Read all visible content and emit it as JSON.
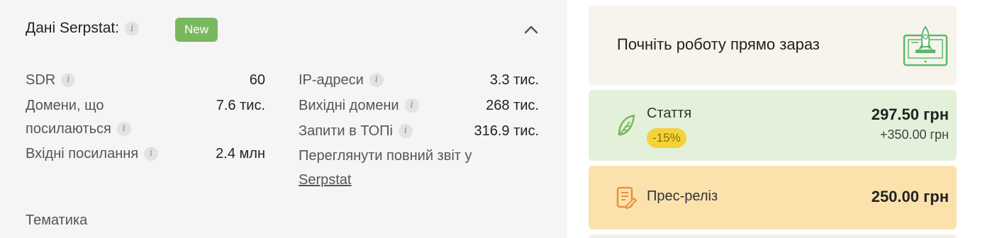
{
  "serpstat": {
    "title": "Дані Serpstat:",
    "badge": "New",
    "metrics_left": [
      {
        "label": "SDR",
        "value": "60"
      },
      {
        "label_line1": "Домени, що",
        "label_line2": "посилаються",
        "value": "7.6 тис."
      },
      {
        "label": "Вхідні посилання",
        "value": "2.4 млн"
      }
    ],
    "metrics_right": [
      {
        "label": "IP-адреси",
        "value": "3.3 тис."
      },
      {
        "label": "Вихідні домени",
        "value": "268 тис."
      },
      {
        "label": "Запити в ТОПі",
        "value": "316.9 тис."
      }
    ],
    "report_text": "Переглянути повний звіт у",
    "report_link": "Serpstat",
    "section_title": "Тематика"
  },
  "start": {
    "text": "Почніть роботу прямо зараз",
    "illustration": "rocket-laptop-illustration"
  },
  "products": [
    {
      "label": "Стаття",
      "discount": "-15%",
      "price": "297.50 грн",
      "extra": "+350.00 грн",
      "icon": "feather-icon",
      "accent": "#7ab85f"
    },
    {
      "label": "Прес-реліз",
      "price": "250.00 грн",
      "icon": "document-edit-icon",
      "accent": "#e8913a"
    }
  ],
  "colors": {
    "green": "#7ab85f",
    "yellow": "#f4d33a",
    "orange": "#fbe2ad",
    "light_green": "#e3f1da"
  }
}
